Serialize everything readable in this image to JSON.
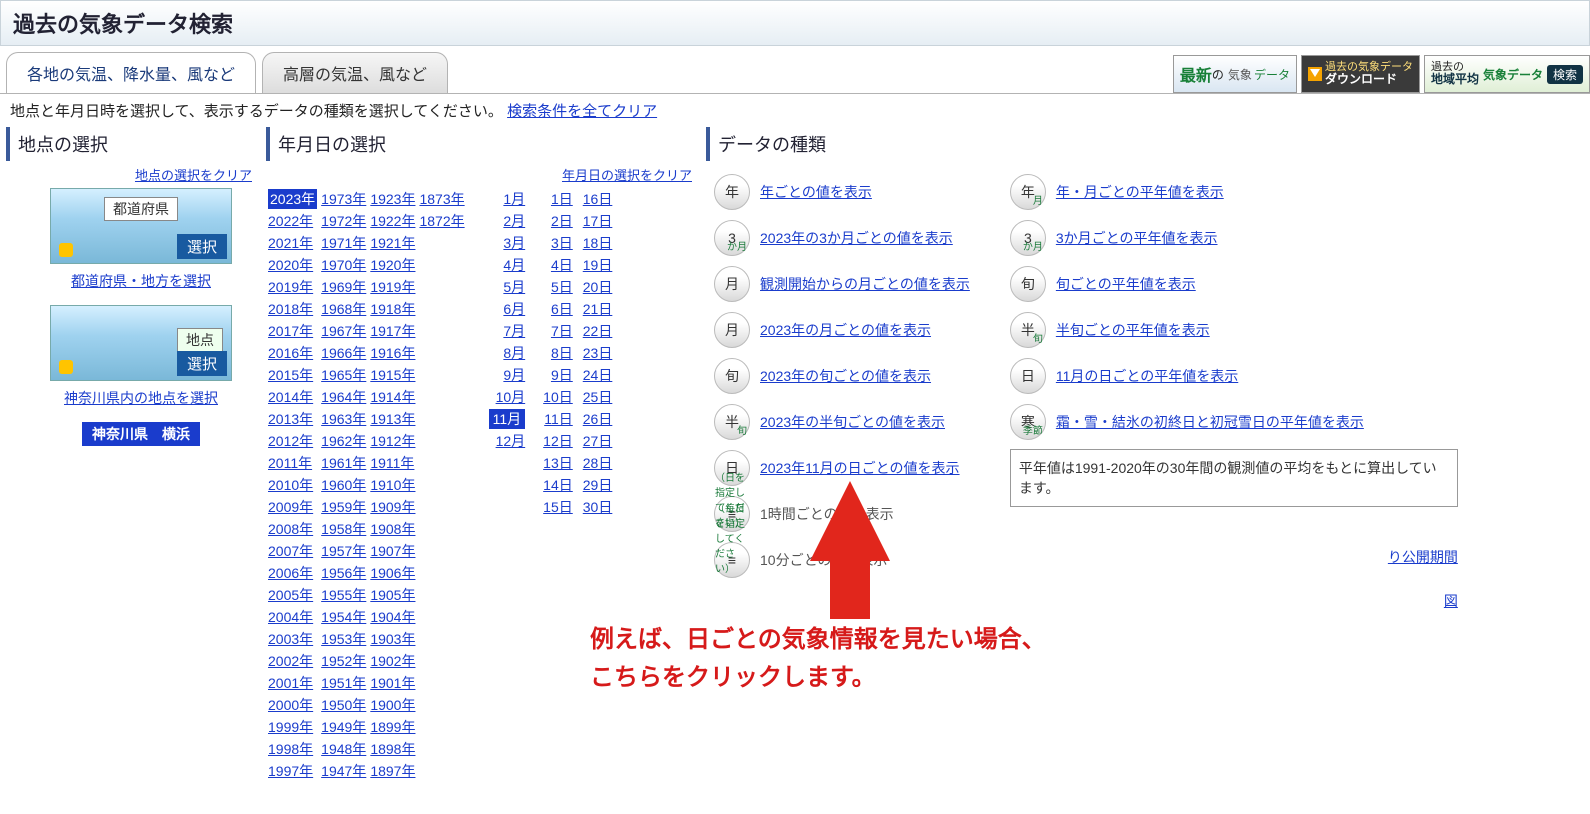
{
  "header": {
    "title": "過去の気象データ検索"
  },
  "tabs": [
    {
      "label": "各地の気温、降水量、風など",
      "active": true
    },
    {
      "label": "高層の気温、風など",
      "active": false
    }
  ],
  "banners": {
    "latest": {
      "t1": "最新",
      "t2": "の",
      "t3": "気象",
      "t4": "データ"
    },
    "download": {
      "t1": "過去の気象データ",
      "t2": "ダウンロード"
    },
    "search": {
      "t1": "過去の",
      "t2": "地域平均",
      "t3": "気象データ",
      "t4": "検索"
    }
  },
  "instruction": {
    "text": "地点と年月日時を選択して、表示するデータの種類を選択してください。",
    "clear": "検索条件を全てクリア"
  },
  "loc": {
    "title": "地点の選択",
    "clear": "地点の選択をクリア",
    "pref_btn": {
      "bar": "都道府県",
      "sel": "選択"
    },
    "pref_link": "都道府県・地方を選択",
    "point_btn": {
      "bar": "地点",
      "sel": "選択"
    },
    "point_link": "神奈川県内の地点を選択",
    "result": "神奈川県　横浜"
  },
  "date": {
    "title": "年月日の選択",
    "clear": "年月日の選択をクリア",
    "year_cols": [
      [
        "2023年",
        "2022年",
        "2021年",
        "2020年",
        "2019年",
        "2018年",
        "2017年",
        "2016年",
        "2015年",
        "2014年",
        "2013年",
        "2012年",
        "2011年",
        "2010年",
        "2009年",
        "2008年",
        "2007年",
        "2006年",
        "2005年",
        "2004年",
        "2003年",
        "2002年",
        "2001年",
        "2000年",
        "1999年",
        "1998年",
        "1997年"
      ],
      [
        "1973年",
        "1972年",
        "1971年",
        "1970年",
        "1969年",
        "1968年",
        "1967年",
        "1966年",
        "1965年",
        "1964年",
        "1963年",
        "1962年",
        "1961年",
        "1960年",
        "1959年",
        "1958年",
        "1957年",
        "1956年",
        "1955年",
        "1954年",
        "1953年",
        "1952年",
        "1951年",
        "1950年",
        "1949年",
        "1948年",
        "1947年"
      ],
      [
        "1923年",
        "1922年",
        "1921年",
        "1920年",
        "1919年",
        "1918年",
        "1917年",
        "1916年",
        "1915年",
        "1914年",
        "1913年",
        "1912年",
        "1911年",
        "1910年",
        "1909年",
        "1908年",
        "1907年",
        "1906年",
        "1905年",
        "1904年",
        "1903年",
        "1902年",
        "1901年",
        "1900年",
        "1899年",
        "1898年",
        "1897年"
      ],
      [
        "1873年",
        "1872年"
      ]
    ],
    "selected_year": "2023年",
    "months": [
      "1月",
      "2月",
      "3月",
      "4月",
      "5月",
      "6月",
      "7月",
      "8月",
      "9月",
      "10月",
      "11月",
      "12月"
    ],
    "selected_month": "11月",
    "days1": [
      "1日",
      "2日",
      "3日",
      "4日",
      "5日",
      "6日",
      "7日",
      "8日",
      "9日",
      "10日",
      "11日",
      "12日",
      "13日",
      "14日",
      "15日"
    ],
    "days2": [
      "16日",
      "17日",
      "18日",
      "19日",
      "20日",
      "21日",
      "22日",
      "23日",
      "24日",
      "25日",
      "26日",
      "27日",
      "28日",
      "29日",
      "30日"
    ]
  },
  "dtype": {
    "title": "データの種類",
    "left": [
      {
        "icon": "年",
        "label": "年ごとの値を表示"
      },
      {
        "icon": "3",
        "sub": "か月",
        "label": "2023年の3か月ごとの値を表示"
      },
      {
        "icon": "月",
        "label": "観測開始からの月ごとの値を表示"
      },
      {
        "icon": "月",
        "label": "2023年の月ごとの値を表示"
      },
      {
        "icon": "旬",
        "label": "2023年の旬ごとの値を表示"
      },
      {
        "icon": "半",
        "sub": "旬",
        "label": "2023年の半旬ごとの値を表示"
      },
      {
        "icon": "日",
        "label": "2023年11月の日ごとの値を表示"
      }
    ],
    "hourly": {
      "icon": "≡",
      "label": "1時間ごとの値を表示",
      "sub": "（日を指定してください）"
    },
    "tenmin": {
      "icon": "≡",
      "label": "10分ごとの値を表示",
      "sub": "（毎日を指定してください）"
    },
    "right": [
      {
        "icon": "年",
        "sub": "月",
        "label": "年・月ごとの平年値を表示"
      },
      {
        "icon": "3",
        "sub": "か月",
        "label": "3か月ごとの平年値を表示"
      },
      {
        "icon": "旬",
        "label": "旬ごとの平年値を表示"
      },
      {
        "icon": "半",
        "sub": "旬",
        "label": "半旬ごとの平年値を表示"
      },
      {
        "icon": "日",
        "label": "11月の日ごとの平年値を表示"
      },
      {
        "icon": "寒",
        "sub": "季節",
        "label": "霜・雪・結氷の初終日と初冠雪日の平年値を表示"
      }
    ],
    "note": "平年値は1991-2020年の30年間の観測値の平均をもとに算出しています。",
    "extra1": "り公開期間",
    "extra2": "図"
  },
  "annot": {
    "line1": "例えば、日ごとの気象情報を見たい場合、",
    "line2": "こちらをクリックします。"
  }
}
